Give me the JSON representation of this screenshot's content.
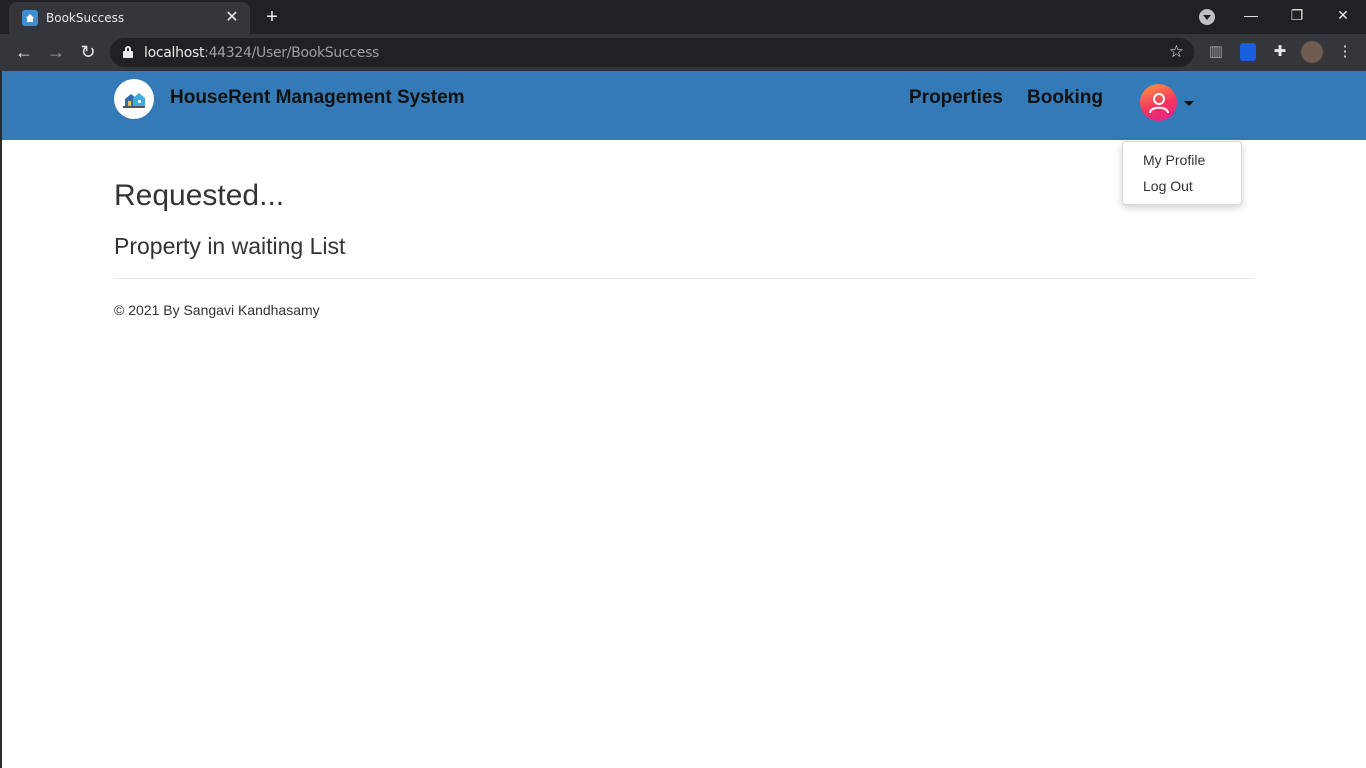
{
  "browser": {
    "tab_title": "BookSuccess",
    "tab_close_icon": "close-icon",
    "new_tab_glyph": "+",
    "url_host": "localhost",
    "url_rest": ":44324/User/BookSuccess",
    "window_controls": {
      "minimize": "—",
      "restore": "❐",
      "close": "✕"
    }
  },
  "navbar": {
    "brand_title": "HouseRent Management System",
    "links": [
      "Properties",
      "Booking"
    ],
    "accent_color": "#337ab7"
  },
  "user_menu": {
    "items": [
      "My Profile",
      "Log Out"
    ]
  },
  "main": {
    "heading": "Requested...",
    "subheading": "Property in waiting List"
  },
  "footer": {
    "text": "© 2021 By Sangavi Kandhasamy"
  }
}
